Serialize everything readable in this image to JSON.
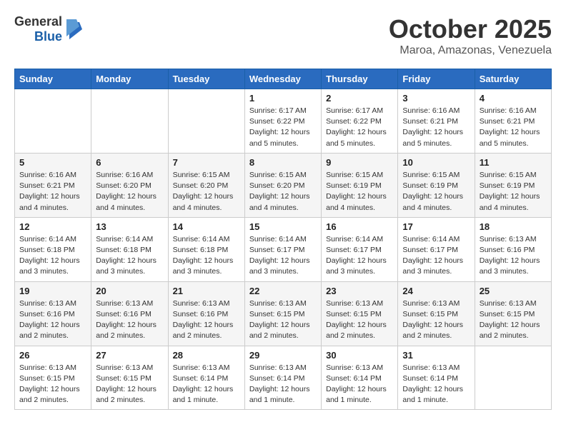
{
  "header": {
    "logo_general": "General",
    "logo_blue": "Blue",
    "month": "October 2025",
    "location": "Maroa, Amazonas, Venezuela"
  },
  "weekdays": [
    "Sunday",
    "Monday",
    "Tuesday",
    "Wednesday",
    "Thursday",
    "Friday",
    "Saturday"
  ],
  "weeks": [
    [
      {
        "day": "",
        "sunrise": "",
        "sunset": "",
        "daylight": ""
      },
      {
        "day": "",
        "sunrise": "",
        "sunset": "",
        "daylight": ""
      },
      {
        "day": "",
        "sunrise": "",
        "sunset": "",
        "daylight": ""
      },
      {
        "day": "1",
        "sunrise": "Sunrise: 6:17 AM",
        "sunset": "Sunset: 6:22 PM",
        "daylight": "Daylight: 12 hours and 5 minutes."
      },
      {
        "day": "2",
        "sunrise": "Sunrise: 6:17 AM",
        "sunset": "Sunset: 6:22 PM",
        "daylight": "Daylight: 12 hours and 5 minutes."
      },
      {
        "day": "3",
        "sunrise": "Sunrise: 6:16 AM",
        "sunset": "Sunset: 6:21 PM",
        "daylight": "Daylight: 12 hours and 5 minutes."
      },
      {
        "day": "4",
        "sunrise": "Sunrise: 6:16 AM",
        "sunset": "Sunset: 6:21 PM",
        "daylight": "Daylight: 12 hours and 5 minutes."
      }
    ],
    [
      {
        "day": "5",
        "sunrise": "Sunrise: 6:16 AM",
        "sunset": "Sunset: 6:21 PM",
        "daylight": "Daylight: 12 hours and 4 minutes."
      },
      {
        "day": "6",
        "sunrise": "Sunrise: 6:16 AM",
        "sunset": "Sunset: 6:20 PM",
        "daylight": "Daylight: 12 hours and 4 minutes."
      },
      {
        "day": "7",
        "sunrise": "Sunrise: 6:15 AM",
        "sunset": "Sunset: 6:20 PM",
        "daylight": "Daylight: 12 hours and 4 minutes."
      },
      {
        "day": "8",
        "sunrise": "Sunrise: 6:15 AM",
        "sunset": "Sunset: 6:20 PM",
        "daylight": "Daylight: 12 hours and 4 minutes."
      },
      {
        "day": "9",
        "sunrise": "Sunrise: 6:15 AM",
        "sunset": "Sunset: 6:19 PM",
        "daylight": "Daylight: 12 hours and 4 minutes."
      },
      {
        "day": "10",
        "sunrise": "Sunrise: 6:15 AM",
        "sunset": "Sunset: 6:19 PM",
        "daylight": "Daylight: 12 hours and 4 minutes."
      },
      {
        "day": "11",
        "sunrise": "Sunrise: 6:15 AM",
        "sunset": "Sunset: 6:19 PM",
        "daylight": "Daylight: 12 hours and 4 minutes."
      }
    ],
    [
      {
        "day": "12",
        "sunrise": "Sunrise: 6:14 AM",
        "sunset": "Sunset: 6:18 PM",
        "daylight": "Daylight: 12 hours and 3 minutes."
      },
      {
        "day": "13",
        "sunrise": "Sunrise: 6:14 AM",
        "sunset": "Sunset: 6:18 PM",
        "daylight": "Daylight: 12 hours and 3 minutes."
      },
      {
        "day": "14",
        "sunrise": "Sunrise: 6:14 AM",
        "sunset": "Sunset: 6:18 PM",
        "daylight": "Daylight: 12 hours and 3 minutes."
      },
      {
        "day": "15",
        "sunrise": "Sunrise: 6:14 AM",
        "sunset": "Sunset: 6:17 PM",
        "daylight": "Daylight: 12 hours and 3 minutes."
      },
      {
        "day": "16",
        "sunrise": "Sunrise: 6:14 AM",
        "sunset": "Sunset: 6:17 PM",
        "daylight": "Daylight: 12 hours and 3 minutes."
      },
      {
        "day": "17",
        "sunrise": "Sunrise: 6:14 AM",
        "sunset": "Sunset: 6:17 PM",
        "daylight": "Daylight: 12 hours and 3 minutes."
      },
      {
        "day": "18",
        "sunrise": "Sunrise: 6:13 AM",
        "sunset": "Sunset: 6:16 PM",
        "daylight": "Daylight: 12 hours and 3 minutes."
      }
    ],
    [
      {
        "day": "19",
        "sunrise": "Sunrise: 6:13 AM",
        "sunset": "Sunset: 6:16 PM",
        "daylight": "Daylight: 12 hours and 2 minutes."
      },
      {
        "day": "20",
        "sunrise": "Sunrise: 6:13 AM",
        "sunset": "Sunset: 6:16 PM",
        "daylight": "Daylight: 12 hours and 2 minutes."
      },
      {
        "day": "21",
        "sunrise": "Sunrise: 6:13 AM",
        "sunset": "Sunset: 6:16 PM",
        "daylight": "Daylight: 12 hours and 2 minutes."
      },
      {
        "day": "22",
        "sunrise": "Sunrise: 6:13 AM",
        "sunset": "Sunset: 6:15 PM",
        "daylight": "Daylight: 12 hours and 2 minutes."
      },
      {
        "day": "23",
        "sunrise": "Sunrise: 6:13 AM",
        "sunset": "Sunset: 6:15 PM",
        "daylight": "Daylight: 12 hours and 2 minutes."
      },
      {
        "day": "24",
        "sunrise": "Sunrise: 6:13 AM",
        "sunset": "Sunset: 6:15 PM",
        "daylight": "Daylight: 12 hours and 2 minutes."
      },
      {
        "day": "25",
        "sunrise": "Sunrise: 6:13 AM",
        "sunset": "Sunset: 6:15 PM",
        "daylight": "Daylight: 12 hours and 2 minutes."
      }
    ],
    [
      {
        "day": "26",
        "sunrise": "Sunrise: 6:13 AM",
        "sunset": "Sunset: 6:15 PM",
        "daylight": "Daylight: 12 hours and 2 minutes."
      },
      {
        "day": "27",
        "sunrise": "Sunrise: 6:13 AM",
        "sunset": "Sunset: 6:15 PM",
        "daylight": "Daylight: 12 hours and 2 minutes."
      },
      {
        "day": "28",
        "sunrise": "Sunrise: 6:13 AM",
        "sunset": "Sunset: 6:14 PM",
        "daylight": "Daylight: 12 hours and 1 minute."
      },
      {
        "day": "29",
        "sunrise": "Sunrise: 6:13 AM",
        "sunset": "Sunset: 6:14 PM",
        "daylight": "Daylight: 12 hours and 1 minute."
      },
      {
        "day": "30",
        "sunrise": "Sunrise: 6:13 AM",
        "sunset": "Sunset: 6:14 PM",
        "daylight": "Daylight: 12 hours and 1 minute."
      },
      {
        "day": "31",
        "sunrise": "Sunrise: 6:13 AM",
        "sunset": "Sunset: 6:14 PM",
        "daylight": "Daylight: 12 hours and 1 minute."
      },
      {
        "day": "",
        "sunrise": "",
        "sunset": "",
        "daylight": ""
      }
    ]
  ]
}
